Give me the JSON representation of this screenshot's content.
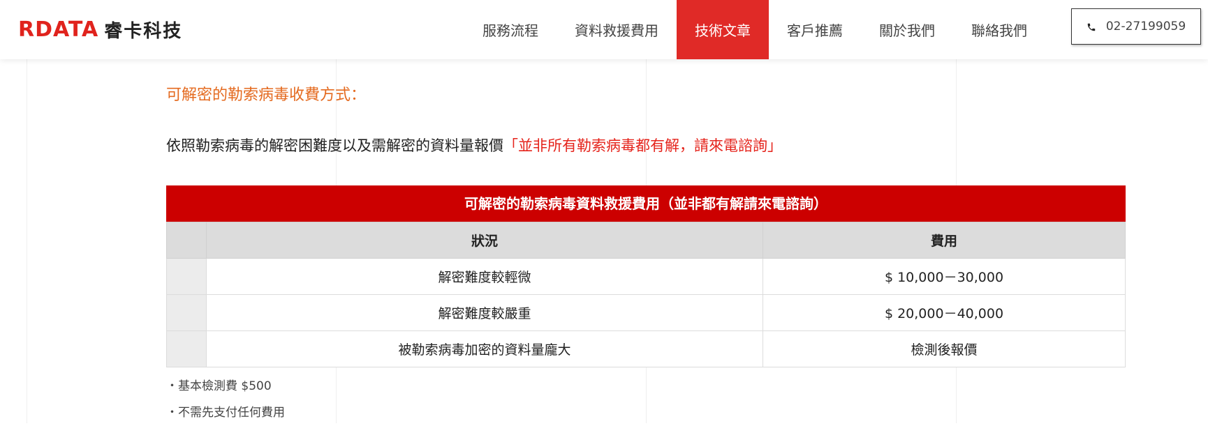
{
  "header": {
    "logo_mark": "RDATA",
    "logo_text": "睿卡科技",
    "nav": [
      {
        "label": "服務流程",
        "active": false
      },
      {
        "label": "資料救援費用",
        "active": false
      },
      {
        "label": "技術文章",
        "active": true
      },
      {
        "label": "客戶推薦",
        "active": false
      },
      {
        "label": "關於我們",
        "active": false
      },
      {
        "label": "聯絡我們",
        "active": false
      }
    ],
    "phone": {
      "icon": "phone-icon",
      "number": "02-27199059"
    }
  },
  "colors": {
    "accent": "#e02a27",
    "table_header": "#cc0000",
    "section_title": "#e46a1f",
    "highlight": "#e5231b"
  },
  "content": {
    "section_title": "可解密的勒索病毒收費方式：",
    "intro_text": "依照勒索病毒的解密困難度以及需解密的資料量報價",
    "intro_highlight": "「並非所有勒索病毒都有解，請來電諮詢」",
    "table": {
      "caption": "可解密的勒索病毒資料救援費用（並非都有解請來電諮詢）",
      "columns": [
        "",
        "狀況",
        "費用"
      ],
      "rows": [
        {
          "index": "",
          "status": "解密難度較輕微",
          "fee": "$ 10,000－30,000"
        },
        {
          "index": "",
          "status": "解密難度較嚴重",
          "fee": "$ 20,000－40,000"
        },
        {
          "index": "",
          "status": "被勒索病毒加密的資料量龐大",
          "fee": "檢測後報價"
        }
      ]
    },
    "notes": [
      "・基本檢測費 $500",
      "・不需先支付任何費用"
    ]
  }
}
